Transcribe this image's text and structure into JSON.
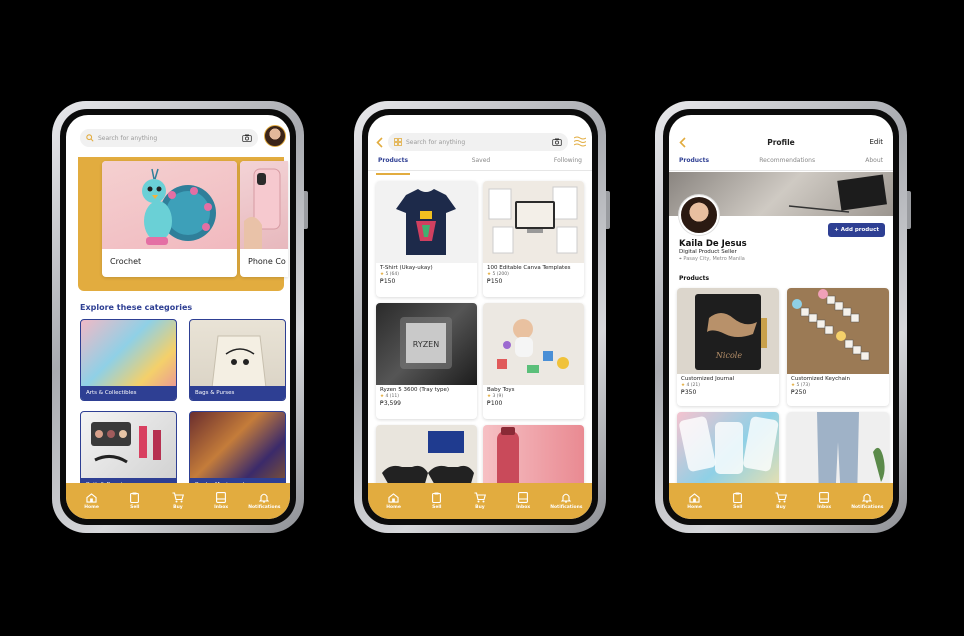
{
  "phone1": {
    "search_placeholder": "Search for anything",
    "banner_cards": [
      "Crochet",
      "Phone Co"
    ],
    "section_title": "Explore these categories",
    "categories": [
      "Arts & Collectibles",
      "Bags & Purses",
      "Bath & Beauty",
      "Books, Music, and ..."
    ]
  },
  "phone2": {
    "search_placeholder": "Search for anything",
    "tabs": [
      "Products",
      "Saved",
      "Following"
    ],
    "products": [
      {
        "title": "T-Shirt (Ukay-ukay)",
        "rating": "5",
        "reviews": "(64)",
        "price": "₱150"
      },
      {
        "title": "100 Editable Canva Templates",
        "rating": "5",
        "reviews": "(200)",
        "price": "₱150"
      },
      {
        "title": "Ryzen 5 3600 (Tray type)",
        "rating": "4",
        "reviews": "(11)",
        "price": "₱3,599"
      },
      {
        "title": "Baby Toys",
        "rating": "3",
        "reviews": "(9)",
        "price": "₱100"
      }
    ]
  },
  "phone3": {
    "header_title": "Profile",
    "edit_label": "Edit",
    "tabs": [
      "Products",
      "Recommendations",
      "About"
    ],
    "name": "Kaila De Jesus",
    "role": "Digital Product Seller",
    "location": "Pasay City, Metro Manila",
    "add_product": "+ Add product",
    "section_title": "Products",
    "products": [
      {
        "title": "Customized Journal",
        "rating": "4",
        "reviews": "(21)",
        "price": "₱350"
      },
      {
        "title": "Customized Keychain",
        "rating": "5",
        "reviews": "(73)",
        "price": "₱250"
      }
    ]
  },
  "nav": [
    "Home",
    "Sell",
    "Buy",
    "Inbox",
    "Notifications"
  ],
  "colors": {
    "accent": "#e2ac3f",
    "navy": "#2e3f93"
  }
}
